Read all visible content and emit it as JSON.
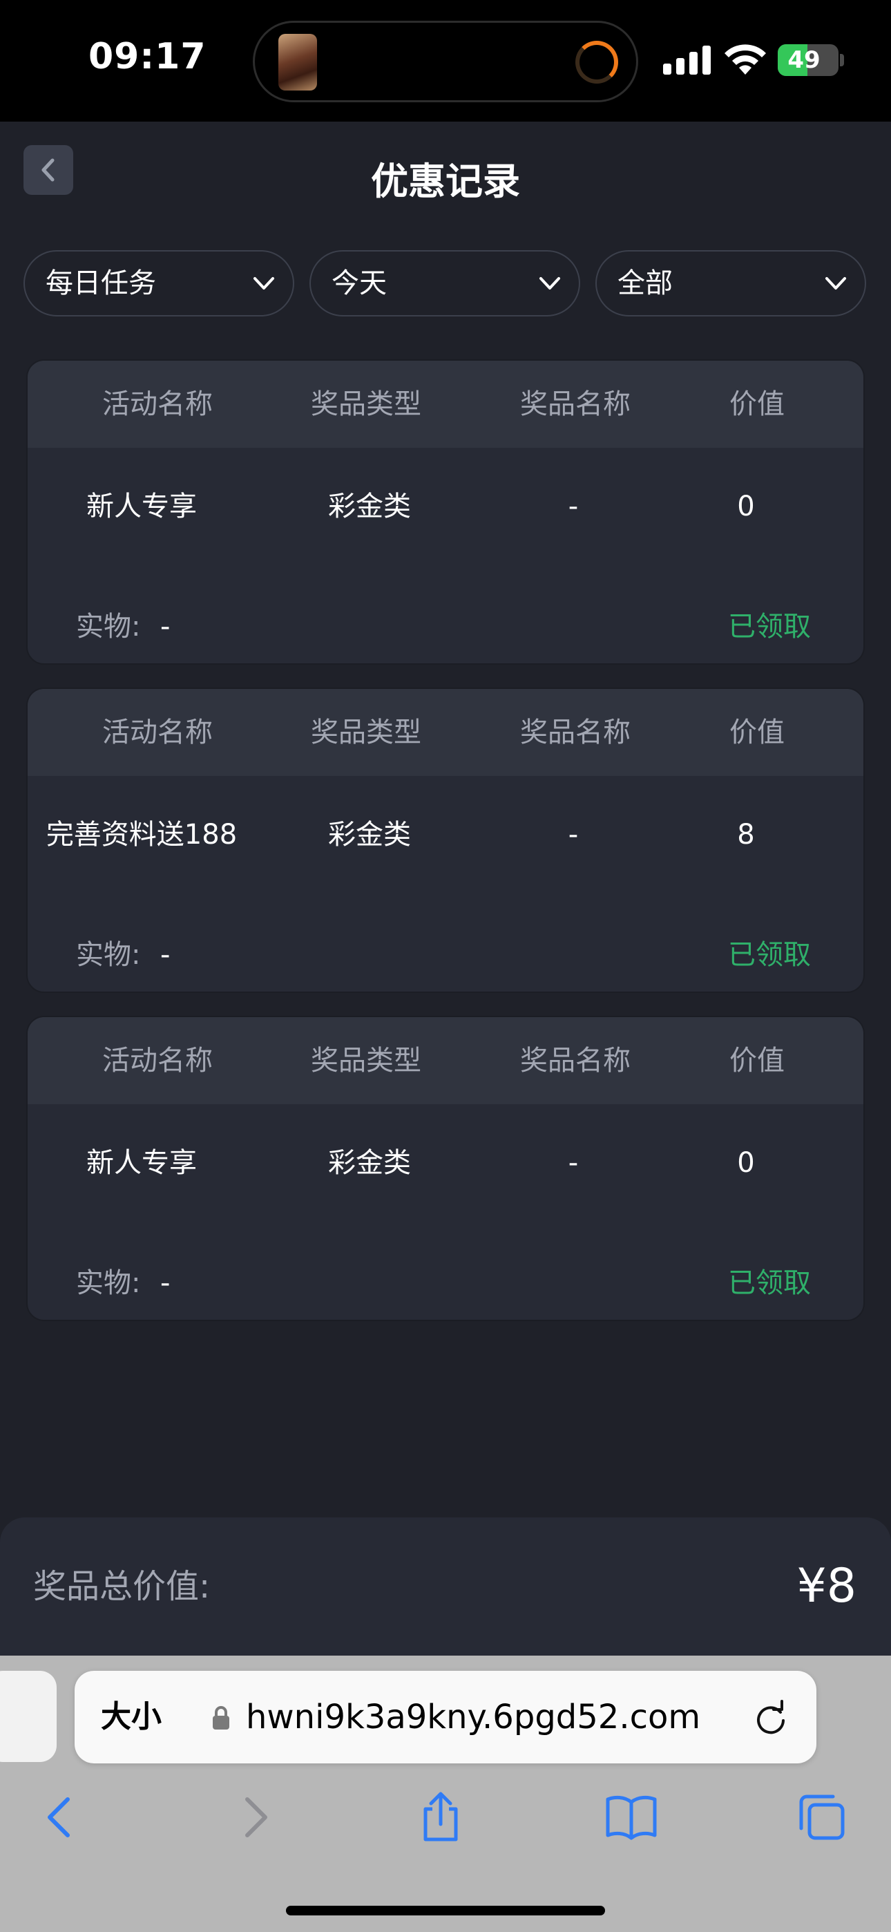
{
  "status_bar": {
    "time": "09:17",
    "battery_percent": "49",
    "battery_level": 0.49
  },
  "header": {
    "title": "优惠记录"
  },
  "filters": [
    {
      "label": "每日任务"
    },
    {
      "label": "今天"
    },
    {
      "label": "全部"
    }
  ],
  "columns": [
    "活动名称",
    "奖品类型",
    "奖品名称",
    "价值"
  ],
  "records": [
    {
      "activity": "新人专享",
      "prize_type": "彩金类",
      "prize_name": "-",
      "value": "0",
      "physical_label": "实物:",
      "physical_value": "-",
      "status": "已领取"
    },
    {
      "activity": "完善资料送188",
      "prize_type": "彩金类",
      "prize_name": "-",
      "value": "8",
      "physical_label": "实物:",
      "physical_value": "-",
      "status": "已领取"
    },
    {
      "activity": "新人专享",
      "prize_type": "彩金类",
      "prize_name": "-",
      "value": "0",
      "physical_label": "实物:",
      "physical_value": "-",
      "status": "已领取"
    }
  ],
  "total": {
    "label": "奖品总价值:",
    "value": "¥8"
  },
  "browser": {
    "text_size_label": "大小",
    "url": "hwni9k3a9kny.6pgd52.com"
  },
  "colors": {
    "background": "#1f2129",
    "card": "#272a35",
    "card_header": "#30343f",
    "claimed_green": "#2fb06a",
    "safari_blue": "#2f7bf5"
  }
}
